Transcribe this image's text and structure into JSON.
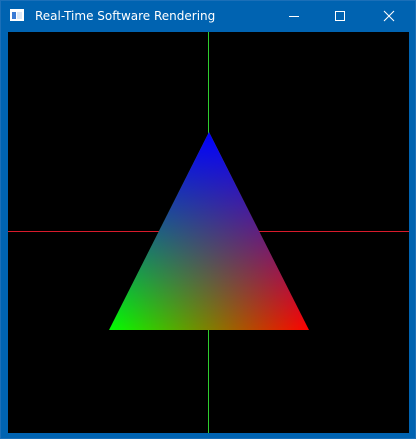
{
  "window": {
    "title": "Real-Time Software Rendering",
    "titlebar_color": "#0063b1",
    "icon": "app-window-icon"
  },
  "caption_buttons": [
    {
      "name": "minimize-button",
      "icon": "minimize-icon"
    },
    {
      "name": "maximize-button",
      "icon": "maximize-icon"
    },
    {
      "name": "close-button",
      "icon": "close-icon"
    }
  ],
  "viewport": {
    "background": "#000000",
    "horizontal_axis_color": "#d81a2b",
    "vertical_axis_color": "#2ecc2e",
    "triangle": {
      "vertices": [
        {
          "label": "top",
          "color": "#0000ff"
        },
        {
          "label": "bottom-left",
          "color": "#00ff00"
        },
        {
          "label": "bottom-right",
          "color": "#ff0000"
        }
      ]
    }
  }
}
